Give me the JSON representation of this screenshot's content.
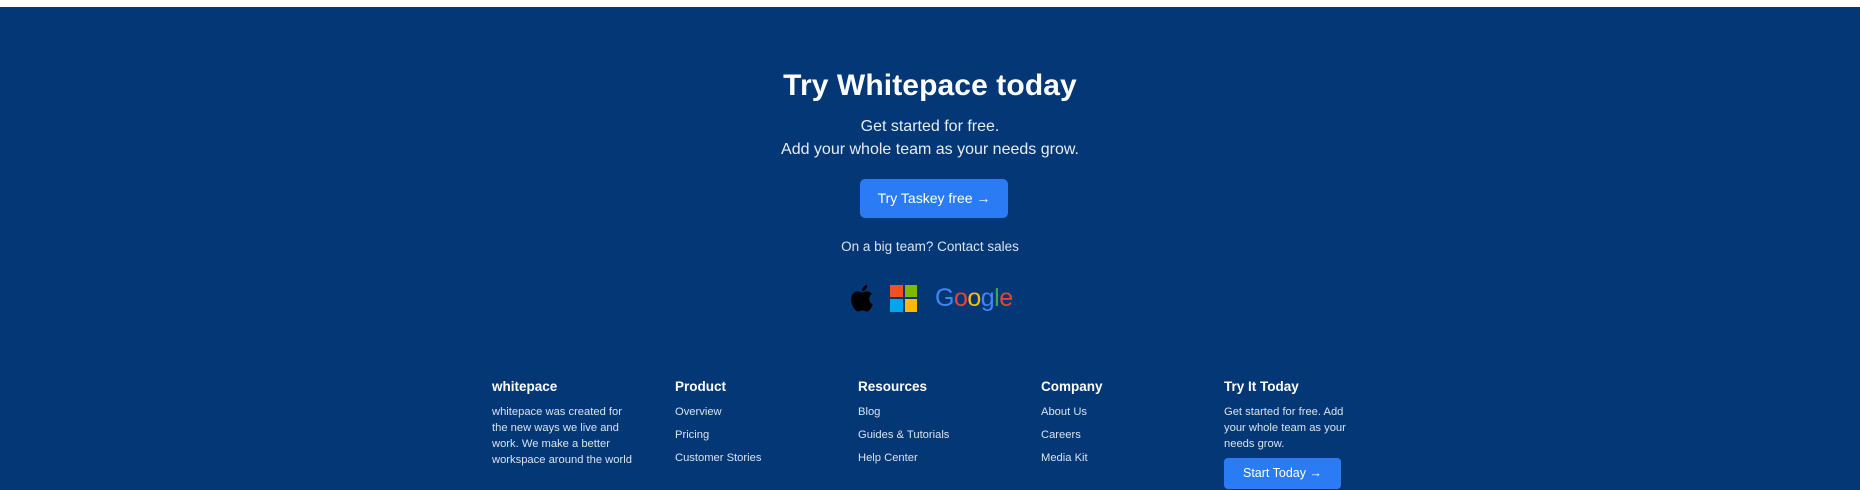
{
  "cta": {
    "title": "Try Whitepace today",
    "subtitle_line1": "Get started for free.",
    "subtitle_line2": "Add your whole team as your needs grow.",
    "button_label": "Try Taskey free →",
    "contact_text": "On a big team? Contact sales"
  },
  "logos": {
    "apple_icon": "apple-logo",
    "microsoft_icon": "microsoft-logo",
    "google_text": [
      "G",
      "o",
      "o",
      "g",
      "l",
      "e"
    ],
    "colors": {
      "apple": "#000000",
      "ms_red": "#f25022",
      "ms_green": "#7fba00",
      "ms_blue": "#00a4ef",
      "ms_yellow": "#ffb900",
      "google_blue": "#4285f4",
      "google_red": "#ea4335",
      "google_yellow": "#fbbc05",
      "google_green": "#34a853"
    }
  },
  "footer": {
    "brand": {
      "heading": "whitepace",
      "text": "whitepace was created for the new ways we live and work. We make a better workspace around the world"
    },
    "product": {
      "heading": "Product",
      "links": [
        "Overview",
        "Pricing",
        "Customer Stories"
      ]
    },
    "resources": {
      "heading": "Resources",
      "links": [
        "Blog",
        "Guides & Tutorials",
        "Help Center"
      ]
    },
    "company": {
      "heading": "Company",
      "links": [
        "About Us",
        "Careers",
        "Media Kit"
      ]
    },
    "try": {
      "heading": "Try It Today",
      "text": "Get started for free. Add your whole team as your needs grow.",
      "button_label": "Start Today →"
    }
  },
  "colors": {
    "background": "#043775",
    "accent": "#2b7cf4",
    "text": "#ffffff"
  }
}
